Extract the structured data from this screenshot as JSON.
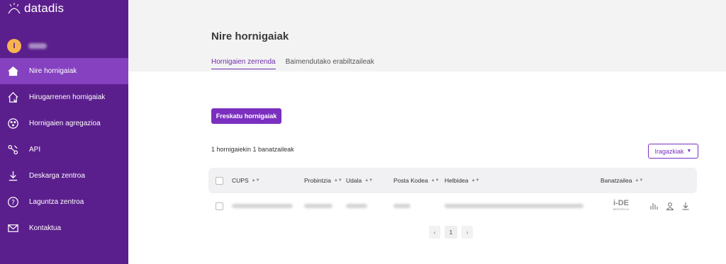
{
  "app": {
    "logo_text": "datadis"
  },
  "user": {
    "initial": "I"
  },
  "sidebar": {
    "items": [
      {
        "label": "Nire hornigaiak",
        "icon": "home-icon",
        "active": true
      },
      {
        "label": "Hirugarrenen hornigaiak",
        "icon": "house-outline-icon",
        "active": false
      },
      {
        "label": "Hornigaien agregazioa",
        "icon": "aggregation-icon",
        "active": false
      },
      {
        "label": "API",
        "icon": "api-icon",
        "active": false
      },
      {
        "label": "Deskarga zentroa",
        "icon": "download-icon",
        "active": false
      },
      {
        "label": "Laguntza zentroa",
        "icon": "help-icon",
        "active": false
      },
      {
        "label": "Kontaktua",
        "icon": "mail-icon",
        "active": false
      }
    ]
  },
  "main": {
    "title": "Nire hornigaiak",
    "tabs": [
      {
        "label": "Hornigaien zerrenda",
        "active": true
      },
      {
        "label": "Baimendutako erabiltzaileak",
        "active": false
      }
    ],
    "sync_button": "Freskatu hornigaiak",
    "summary": "1 hornigaiekin 1 banatzaileak",
    "filters_button": "Iragazkiak",
    "table": {
      "columns": [
        "CUPS",
        "Probintzia",
        "Udala",
        "Posta Kodea",
        "Helbidea",
        "Banatzailea"
      ],
      "rows": [
        {
          "distributor_logo": "i-DE",
          "distributor_sub": "IBERDROLA"
        }
      ]
    },
    "pagination": {
      "prev": "‹",
      "current": "1",
      "next": "›"
    }
  },
  "colors": {
    "sidebar_bg": "#5b1f8d",
    "active_item": "#8541c0",
    "accent": "#7b2fbf"
  }
}
